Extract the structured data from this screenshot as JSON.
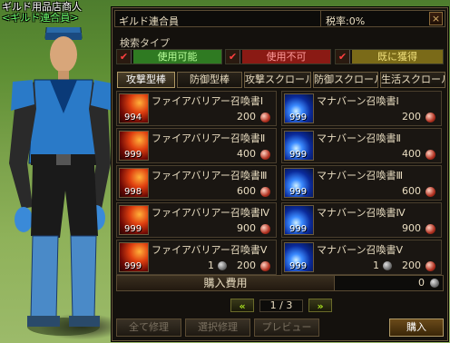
{
  "npc": {
    "name": "ギルド用品店商人",
    "guild": "<ギルド連合員>"
  },
  "window": {
    "title": "ギルド連合員",
    "tax": "税率:0%",
    "close": "×"
  },
  "search": {
    "label": "検索タイプ",
    "filters": [
      {
        "label": "使用可能",
        "color": "#2f7a22"
      },
      {
        "label": "使用不可",
        "color": "#8a1a14"
      },
      {
        "label": "既に獲得",
        "color": "#7a6a18"
      }
    ]
  },
  "tabs": [
    "攻撃型棒",
    "防御型棒",
    "攻撃スクロール",
    "防御スクロール",
    "生活スクロール"
  ],
  "items": [
    {
      "name": "ファイアバリアー召喚書Ⅰ",
      "qty": "994",
      "price": "200",
      "icon": "fire-scroll-icon"
    },
    {
      "name": "マナバーン召喚書Ⅰ",
      "qty": "999",
      "price": "200",
      "icon": "mana-scroll-icon"
    },
    {
      "name": "ファイアバリアー召喚書Ⅱ",
      "qty": "999",
      "price": "400",
      "icon": "fire-scroll-icon"
    },
    {
      "name": "マナバーン召喚書Ⅱ",
      "qty": "999",
      "price": "400",
      "icon": "mana-scroll-icon"
    },
    {
      "name": "ファイアバリアー召喚書Ⅲ",
      "qty": "998",
      "price": "600",
      "icon": "fire-scroll-icon"
    },
    {
      "name": "マナバーン召喚書Ⅲ",
      "qty": "999",
      "price": "600",
      "icon": "mana-scroll-icon"
    },
    {
      "name": "ファイアバリアー召喚書Ⅳ",
      "qty": "999",
      "price": "900",
      "icon": "fire-scroll-icon"
    },
    {
      "name": "マナバーン召喚書Ⅳ",
      "qty": "999",
      "price": "900",
      "icon": "mana-scroll-icon"
    },
    {
      "name": "ファイアバリアー召喚書Ⅴ",
      "qty": "999",
      "price": "200",
      "extra": "1",
      "icon": "fire-scroll-icon"
    },
    {
      "name": "マナバーン召喚書Ⅴ",
      "qty": "999",
      "price": "200",
      "extra": "1",
      "icon": "mana-scroll-icon"
    }
  ],
  "cost": {
    "label": "購入費用",
    "value": "0"
  },
  "pager": {
    "prev": "«",
    "page": "1 / 3",
    "next": "»"
  },
  "buttons": {
    "repair_all": "全て修理",
    "repair_sel": "選択修理",
    "preview": "プレビュー",
    "buy": "購入"
  }
}
